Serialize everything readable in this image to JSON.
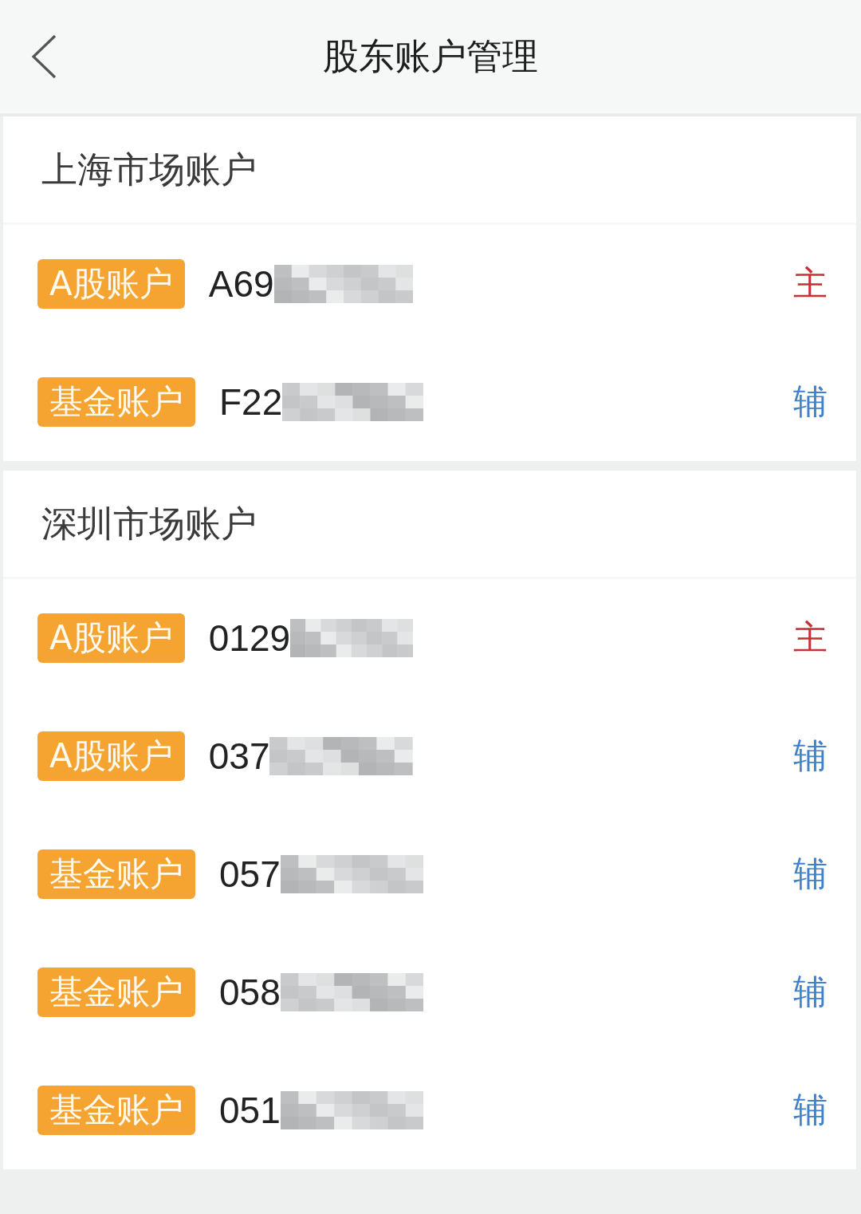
{
  "header": {
    "title": "股东账户管理"
  },
  "sections": [
    {
      "title": "上海市场账户",
      "accounts": [
        {
          "type": "A股账户",
          "number": "A69",
          "role": "主",
          "primary": true
        },
        {
          "type": "基金账户",
          "number": "F22",
          "role": "辅",
          "primary": false
        }
      ]
    },
    {
      "title": "深圳市场账户",
      "accounts": [
        {
          "type": "A股账户",
          "number": "0129",
          "role": "主",
          "primary": true
        },
        {
          "type": "A股账户",
          "number": "037",
          "role": "辅",
          "primary": false
        },
        {
          "type": "基金账户",
          "number": "057",
          "role": "辅",
          "primary": false
        },
        {
          "type": "基金账户",
          "number": "058",
          "role": "辅",
          "primary": false
        },
        {
          "type": "基金账户",
          "number": "051",
          "role": "辅",
          "primary": false
        }
      ]
    }
  ]
}
